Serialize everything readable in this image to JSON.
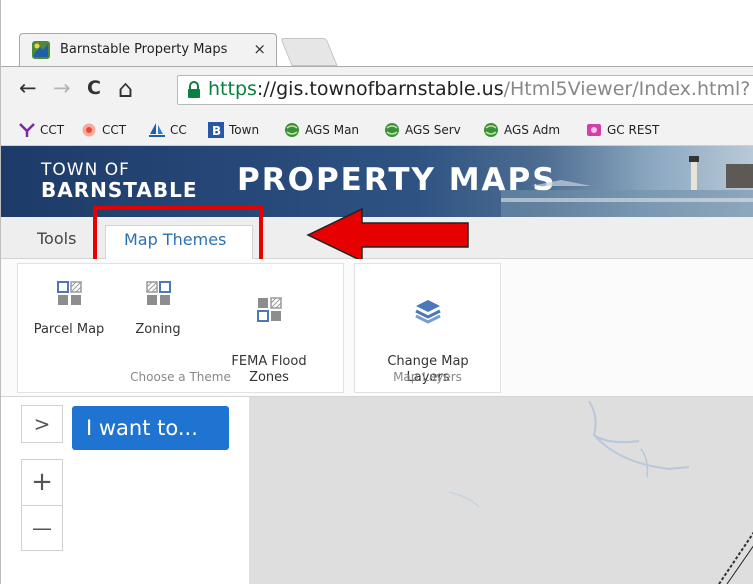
{
  "browser": {
    "tab": {
      "title": "Barnstable Property Maps",
      "close": "×"
    },
    "toolbar": {
      "back": "←",
      "forward": "→",
      "reload": "C",
      "home": "⌂",
      "url_scheme": "https",
      "url_sep": "://",
      "url_host": "gis.townofbarnstable.us",
      "url_path": "/Html5Viewer/Index.html?"
    },
    "bookmarks": [
      {
        "label": "CCT"
      },
      {
        "label": "CCT"
      },
      {
        "label": "CC"
      },
      {
        "label": "Town"
      },
      {
        "label": "AGS Man"
      },
      {
        "label": "AGS Serv"
      },
      {
        "label": "AGS Adm"
      },
      {
        "label": "GC REST"
      }
    ]
  },
  "app": {
    "banner": {
      "town_line1": "TOWN OF",
      "town_line2": "BARNSTABLE",
      "title": "PROPERTY MAPS"
    },
    "ribbon_tabs": {
      "tools": "Tools",
      "map_themes": "Map Themes"
    },
    "groups": {
      "choose_theme": {
        "label": "Choose a Theme",
        "buttons": [
          "Parcel Map",
          "Zoning",
          "FEMA Flood\nZones"
        ]
      },
      "map_layers": {
        "label": "Map Layers",
        "buttons": [
          "Change Map\nLayers"
        ]
      }
    },
    "map_controls": {
      "expand": ">",
      "i_want_to": "I want to...",
      "zoom_in": "+",
      "zoom_out": "—"
    }
  },
  "colors": {
    "accent_blue": "#1f73d1",
    "tab_blue": "#2d6fb7",
    "highlight_red": "#e60000",
    "url_green": "#0b8043"
  }
}
